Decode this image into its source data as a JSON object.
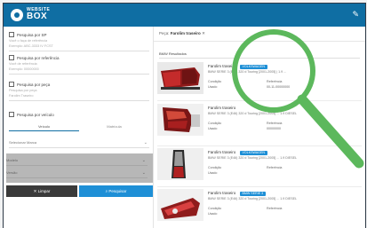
{
  "header": {
    "brand_top": "WEBSITE",
    "brand_bottom": "BOX"
  },
  "sidebar": {
    "section1_label": "Pesquisa por SP",
    "section1_hint1": "Você o faça de referência",
    "section1_hint2": "Exemplo: ABC-3333 IV FCST",
    "section2_label": "Pesquisa por referência",
    "section2_hint1": "Você de referência",
    "section2_hint2": "Exemplo: 00000000",
    "section3_label": "Pesquisa por peça",
    "section3_hint1": "Pesquisa por peça",
    "section3_hint2": "Farolim Traseiro",
    "section4_label": "Pesquisa por veículo",
    "tab_active": "Veículo",
    "tab_inactive": "Matrícula",
    "select_brand": "Selecionar Marca",
    "select_model": "Modelo",
    "select_version": "Versão",
    "btn_clear": "Limpar",
    "btn_search": "Pesquisar"
  },
  "main": {
    "breadcrumb_prefix": "Peça:",
    "breadcrumb_value": "Farolim traseiro",
    "results_label": "BMW Resultados",
    "cards": [
      {
        "title": "Farolim traseiro",
        "tag": "VOLKSWAGEN",
        "code": "BMW SERIE 3 (E46) 320 d Touring [2001-2005] | 1.9 ...",
        "left_label1": "Condição",
        "left_label2": "Usado",
        "right_label1": "Referência",
        "right_value": "00-11-00000000"
      },
      {
        "title": "Farolim traseiro",
        "tag": "",
        "code": "BMW SERIE 3 (E46) 320 d Touring [2001-2005] ... 1.9 DIESEL",
        "left_label1": "Condição",
        "left_label2": "Usado",
        "right_label1": "Referência",
        "right_value": "00000000"
      },
      {
        "title": "Farolim traseiro",
        "tag": "VOLKSWAGEN",
        "code": "BMW SERIE 3 (E46) 320 d Touring [2001-2005] ... 1.9 DIESEL",
        "left_label1": "Condição",
        "left_label2": "Usado",
        "right_label1": "Referência",
        "right_value": ""
      },
      {
        "title": "Farolim traseiro",
        "tag": "BMW SERIE 3",
        "code": "BMW SERIE 3 (E46) 320 d Touring [2001-2005] ... 1.9 DIESEL",
        "left_label1": "Condição",
        "left_label2": "Usado",
        "right_label1": "Referência",
        "right_value": ""
      }
    ]
  },
  "colors": {
    "header": "#0f6ea3",
    "accent": "#1e8fd6",
    "magnifier": "#5cb85c"
  },
  "icons": [
    "logo-mark-icon",
    "settings-icon",
    "magnifier-icon",
    "chevron-down-icon"
  ]
}
